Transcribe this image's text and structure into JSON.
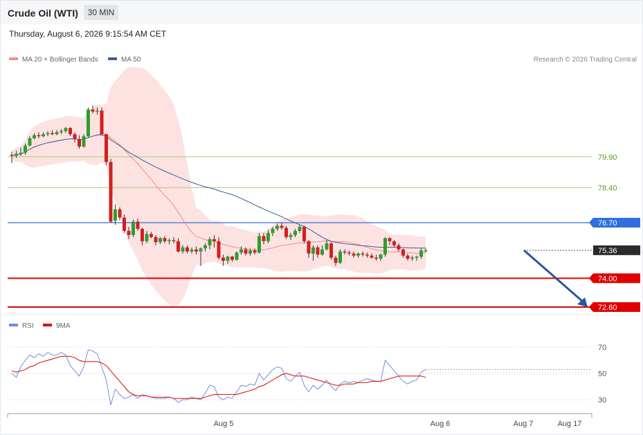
{
  "header": {
    "title": "Crude Oil (WTI)",
    "timeframe": "30 MIN",
    "datetime": "Thursday, August 6, 2026 9:15:54 AM CET"
  },
  "legend": {
    "ma20": "MA 20 + Bollinger Bands",
    "ma50": "MA 50",
    "credit": "Research © 2026 Trading Central"
  },
  "rsi_legend": {
    "rsi": "RSI",
    "ma9": "9MA"
  },
  "colors": {
    "bollinger": "#fde2e2",
    "ma20": "#f28b8b",
    "ma50": "#3b5b9a",
    "bull": "#2e9e2e",
    "bear": "#d31f1f",
    "resistance": "#2f6fde",
    "support": "#e00000",
    "target": "#a9c97a",
    "arrow": "#2a56a0",
    "rsi": "#6f8fdc",
    "rsi_ma": "#e00000"
  },
  "chart_data": [
    {
      "type": "candlestick",
      "title": "Crude Oil (WTI)",
      "ylim": [
        72.1,
        81.9
      ],
      "levels": [
        {
          "value": 79.9,
          "label": "79.90",
          "kind": "target"
        },
        {
          "value": 78.4,
          "label": "78.40",
          "kind": "target"
        },
        {
          "value": 76.7,
          "label": "76.70",
          "kind": "resistance"
        },
        {
          "value": 75.36,
          "label": "75.36",
          "kind": "last"
        },
        {
          "value": 74.0,
          "label": "74.00",
          "kind": "support"
        },
        {
          "value": 72.6,
          "label": "72.60",
          "kind": "support"
        }
      ],
      "x_ticks": [
        "Aug 5",
        "Aug 6",
        "Aug 7",
        "Aug 17"
      ],
      "ohlc": [
        [
          80.0,
          80.15,
          79.6,
          79.95
        ],
        [
          79.95,
          80.2,
          79.85,
          80.05
        ],
        [
          80.05,
          80.35,
          79.95,
          80.1
        ],
        [
          80.1,
          80.55,
          80.0,
          80.45
        ],
        [
          80.45,
          80.9,
          80.4,
          80.8
        ],
        [
          80.8,
          81.05,
          80.75,
          80.95
        ],
        [
          80.95,
          81.1,
          80.8,
          80.9
        ],
        [
          80.9,
          81.1,
          80.85,
          81.0
        ],
        [
          81.0,
          81.15,
          80.9,
          81.05
        ],
        [
          81.05,
          81.2,
          80.95,
          81.0
        ],
        [
          81.0,
          81.2,
          80.95,
          81.1
        ],
        [
          81.1,
          81.25,
          81.0,
          81.15
        ],
        [
          81.15,
          81.35,
          81.05,
          81.3
        ],
        [
          81.3,
          81.35,
          80.9,
          81.0
        ],
        [
          81.0,
          81.1,
          80.6,
          80.75
        ],
        [
          80.75,
          80.95,
          80.3,
          80.4
        ],
        [
          80.4,
          81.0,
          80.35,
          80.9
        ],
        [
          80.9,
          82.3,
          80.85,
          82.2
        ],
        [
          82.2,
          82.4,
          82.0,
          82.1
        ],
        [
          82.1,
          82.3,
          81.95,
          82.15
        ],
        [
          82.15,
          82.3,
          80.95,
          81.0
        ],
        [
          81.0,
          81.0,
          79.5,
          79.65
        ],
        [
          79.65,
          79.8,
          76.7,
          76.75
        ],
        [
          76.8,
          77.6,
          76.6,
          77.35
        ],
        [
          77.35,
          77.45,
          76.8,
          76.95
        ],
        [
          76.95,
          77.1,
          76.2,
          76.3
        ],
        [
          76.3,
          76.5,
          75.9,
          76.1
        ],
        [
          76.1,
          76.85,
          76.0,
          76.75
        ],
        [
          76.75,
          76.9,
          76.3,
          76.4
        ],
        [
          76.4,
          76.45,
          75.6,
          75.8
        ],
        [
          75.8,
          76.3,
          75.7,
          76.15
        ],
        [
          76.15,
          76.25,
          75.95,
          76.0
        ],
        [
          76.0,
          76.1,
          75.6,
          75.75
        ],
        [
          75.75,
          76.0,
          75.65,
          75.95
        ],
        [
          75.95,
          76.05,
          75.7,
          75.8
        ],
        [
          75.8,
          75.95,
          75.65,
          75.85
        ],
        [
          75.85,
          76.0,
          75.7,
          75.8
        ],
        [
          75.8,
          75.95,
          75.25,
          75.3
        ],
        [
          75.3,
          75.6,
          75.2,
          75.5
        ],
        [
          75.5,
          75.6,
          75.2,
          75.3
        ],
        [
          75.3,
          75.5,
          75.2,
          75.4
        ],
        [
          75.4,
          75.55,
          75.15,
          75.3
        ],
        [
          75.3,
          75.5,
          74.6,
          75.45
        ],
        [
          75.45,
          75.7,
          75.3,
          75.6
        ],
        [
          75.6,
          76.0,
          75.4,
          75.9
        ],
        [
          75.9,
          76.1,
          75.5,
          75.8
        ],
        [
          75.8,
          76.0,
          74.9,
          75.0
        ],
        [
          75.0,
          75.15,
          74.6,
          74.85
        ],
        [
          74.85,
          75.1,
          74.7,
          75.05
        ],
        [
          75.05,
          75.1,
          74.8,
          74.9
        ],
        [
          74.9,
          75.3,
          74.85,
          75.25
        ],
        [
          75.25,
          75.55,
          75.15,
          75.4
        ],
        [
          75.4,
          75.5,
          75.1,
          75.2
        ],
        [
          75.2,
          75.45,
          75.1,
          75.35
        ],
        [
          75.35,
          75.45,
          75.15,
          75.25
        ],
        [
          75.25,
          76.2,
          75.2,
          76.05
        ],
        [
          76.05,
          76.2,
          75.65,
          75.8
        ],
        [
          75.8,
          76.35,
          75.7,
          76.2
        ],
        [
          76.2,
          76.5,
          76.05,
          76.4
        ],
        [
          76.4,
          76.65,
          76.3,
          76.55
        ],
        [
          76.55,
          76.7,
          76.35,
          76.45
        ],
        [
          76.45,
          76.55,
          75.9,
          76.0
        ],
        [
          76.0,
          76.2,
          75.85,
          76.1
        ],
        [
          76.1,
          76.4,
          76.0,
          76.3
        ],
        [
          76.3,
          76.6,
          76.2,
          76.5
        ],
        [
          76.5,
          76.55,
          75.7,
          75.8
        ],
        [
          75.8,
          75.85,
          75.0,
          75.2
        ],
        [
          75.2,
          75.6,
          74.85,
          75.5
        ],
        [
          75.5,
          75.6,
          75.0,
          75.15
        ],
        [
          75.15,
          75.6,
          75.1,
          75.4
        ],
        [
          75.4,
          75.85,
          75.35,
          75.7
        ],
        [
          75.7,
          75.75,
          74.9,
          75.0
        ],
        [
          75.0,
          75.1,
          74.6,
          74.75
        ],
        [
          74.75,
          75.4,
          74.7,
          75.3
        ],
        [
          75.3,
          75.4,
          75.15,
          75.25
        ],
        [
          75.25,
          75.35,
          75.1,
          75.2
        ],
        [
          75.2,
          75.3,
          75.0,
          75.1
        ],
        [
          75.1,
          75.25,
          75.0,
          75.2
        ],
        [
          75.2,
          75.3,
          75.05,
          75.15
        ],
        [
          75.15,
          75.25,
          75.0,
          75.1
        ],
        [
          75.1,
          75.2,
          74.95,
          75.0
        ],
        [
          75.0,
          75.15,
          74.85,
          74.95
        ],
        [
          74.95,
          75.2,
          74.85,
          75.15
        ],
        [
          75.15,
          76.0,
          75.05,
          75.95
        ],
        [
          75.95,
          76.0,
          75.6,
          75.8
        ],
        [
          75.8,
          75.85,
          75.5,
          75.6
        ],
        [
          75.6,
          75.7,
          75.3,
          75.4
        ],
        [
          75.4,
          75.45,
          75.0,
          75.1
        ],
        [
          75.1,
          75.2,
          74.85,
          74.95
        ],
        [
          74.95,
          75.1,
          74.85,
          75.0
        ],
        [
          75.0,
          75.1,
          74.85,
          75.05
        ],
        [
          75.05,
          75.45,
          74.95,
          75.35
        ],
        [
          75.35,
          75.45,
          75.25,
          75.36
        ]
      ]
    },
    {
      "type": "line",
      "title": "RSI",
      "ylim": [
        22,
        78
      ],
      "y_ticks": [
        70,
        50,
        30
      ],
      "series": [
        {
          "name": "RSI",
          "values": [
            50,
            47,
            55,
            60,
            64,
            62,
            65,
            63,
            66,
            64,
            64,
            66,
            64,
            56,
            52,
            48,
            55,
            68,
            67,
            65,
            55,
            45,
            26,
            38,
            34,
            31,
            32,
            34,
            31,
            34,
            33,
            32,
            31,
            31,
            31,
            32,
            31,
            28,
            30,
            30,
            32,
            31,
            30,
            35,
            41,
            40,
            32,
            30,
            32,
            31,
            36,
            41,
            40,
            42,
            41,
            50,
            45,
            49,
            53,
            55,
            54,
            46,
            44,
            48,
            51,
            41,
            36,
            41,
            38,
            41,
            45,
            40,
            37,
            42,
            44,
            43,
            44,
            43,
            45,
            46,
            45,
            44,
            44,
            60,
            56,
            52,
            48,
            44,
            42,
            44,
            45,
            51,
            53
          ]
        },
        {
          "name": "9MA",
          "values": [
            52,
            51,
            52,
            53,
            55,
            56,
            58,
            59,
            60,
            61,
            62,
            63,
            63,
            63,
            62,
            60,
            59,
            59,
            59,
            59,
            58,
            56,
            52,
            48,
            44,
            40,
            36,
            34,
            33,
            33,
            33,
            32,
            32,
            32,
            32,
            32,
            31,
            31,
            31,
            31,
            31,
            31,
            31,
            32,
            33,
            34,
            34,
            34,
            34,
            34,
            34,
            35,
            36,
            37,
            38,
            40,
            41,
            43,
            45,
            47,
            49,
            50,
            49,
            48,
            48,
            48,
            47,
            46,
            45,
            44,
            43,
            42,
            41,
            41,
            42,
            42,
            42,
            43,
            43,
            43,
            44,
            44,
            44,
            45,
            46,
            47,
            48,
            48,
            48,
            48,
            48,
            48,
            47
          ]
        }
      ]
    }
  ]
}
